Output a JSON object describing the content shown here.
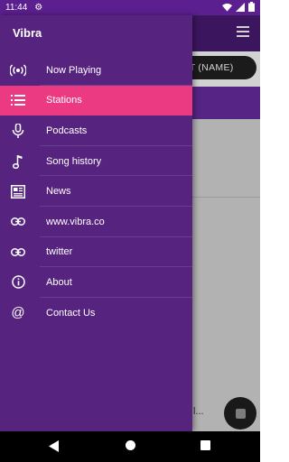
{
  "status": {
    "time": "11:44"
  },
  "app": {
    "sort_label": "RT (NAME)",
    "partial_text": "l..."
  },
  "drawer": {
    "title": "Vibra",
    "items": [
      {
        "label": "Now Playing",
        "icon": "radio-waves-icon",
        "active": false
      },
      {
        "label": "Stations",
        "icon": "list-icon",
        "active": true
      },
      {
        "label": "Podcasts",
        "icon": "microphone-icon",
        "active": false
      },
      {
        "label": "Song history",
        "icon": "music-note-icon",
        "active": false
      },
      {
        "label": "News",
        "icon": "newspaper-icon",
        "active": false
      },
      {
        "label": "www.vibra.co",
        "icon": "link-icon",
        "active": false
      },
      {
        "label": "twitter",
        "icon": "link-icon",
        "active": false
      },
      {
        "label": "About",
        "icon": "info-icon",
        "active": false
      },
      {
        "label": "Contact Us",
        "icon": "at-sign-icon",
        "active": false
      }
    ]
  },
  "colors": {
    "drawer_bg": "#56247f",
    "active_bg": "#ec3a82",
    "statusbar_bg": "#5b1f8f"
  }
}
